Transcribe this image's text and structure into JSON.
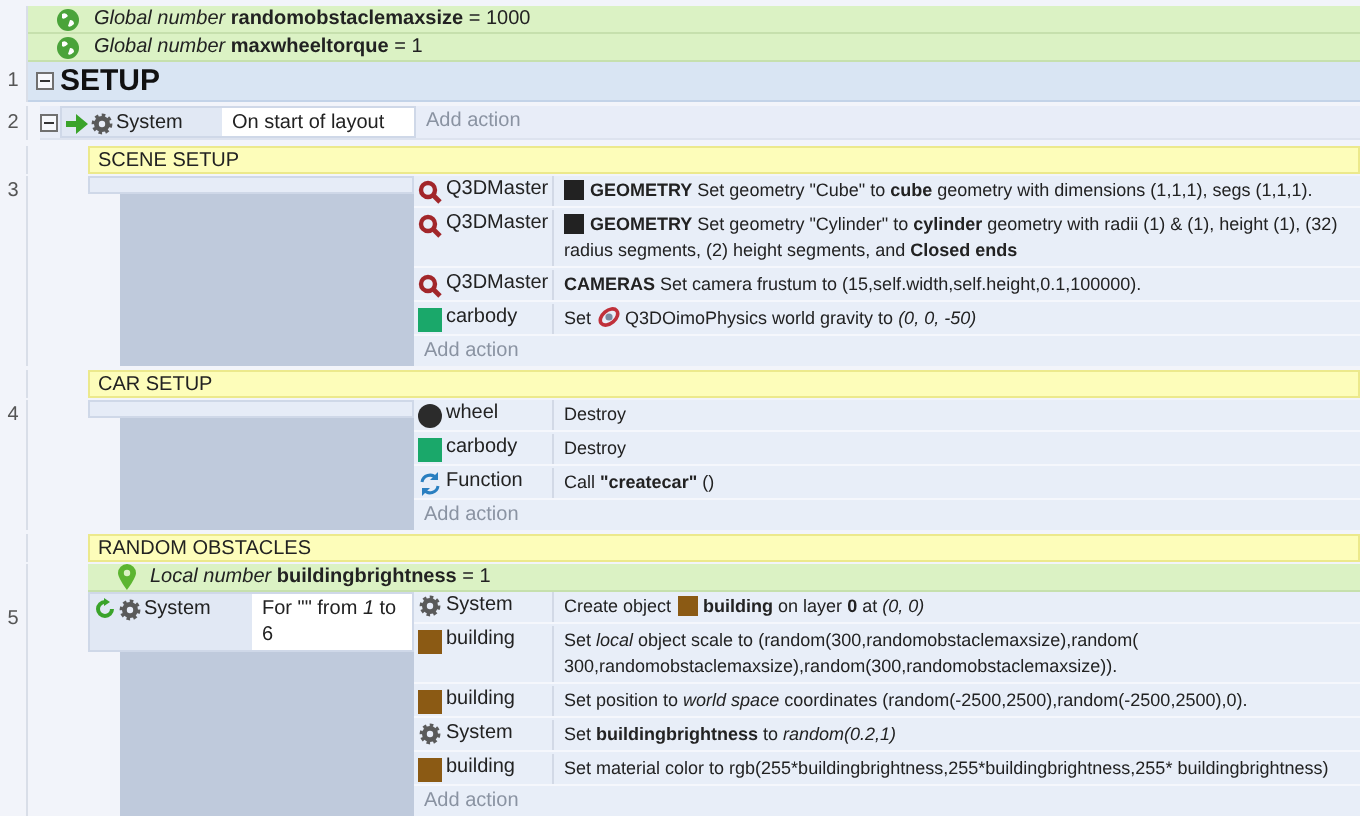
{
  "globals": [
    {
      "text": "*Global number* **randomobstaclemaxsize** = 1000"
    },
    {
      "text": "*Global number* **maxwheeltorque** = 1"
    }
  ],
  "group": {
    "number": "1",
    "title": "SETUP",
    "expanded": true,
    "event": {
      "number": "2",
      "expanded": true,
      "condition": {
        "kind": "trigger",
        "object": "System",
        "text": "On start of layout"
      },
      "add_action": "Add action",
      "subgroups": [
        {
          "title": "SCENE SETUP",
          "event": {
            "number": "3",
            "add_action": "Add action",
            "actions": [
              {
                "kind": "plugin",
                "object": "Q3DMaster",
                "segments": [
                  {
                    "kind": "swatch",
                    "color": "#222222"
                  },
                  {
                    "kind": "rich",
                    "text": "**GEOMETRY** Set geometry \"Cube\" to **cube** geometry with dimensions (1,1,1), segs (1,1,1)."
                  }
                ]
              },
              {
                "kind": "plugin",
                "object": "Q3DMaster",
                "segments": [
                  {
                    "kind": "swatch",
                    "color": "#222222"
                  },
                  {
                    "kind": "rich",
                    "text": "**GEOMETRY** Set geometry \"Cylinder\" to **cylinder** geometry with radii (1) & (1), height (1), (32) radius segments, (2) height segments, and **Closed ends**"
                  }
                ]
              },
              {
                "kind": "plugin",
                "object": "Q3DMaster",
                "segments": [
                  {
                    "kind": "rich",
                    "text": "**CAMERAS** Set camera frustum to (15,self.width,self.height,0.1,100000)."
                  }
                ]
              },
              {
                "kind": "box",
                "color": "#1aa86a",
                "object": "carbody",
                "segments": [
                  {
                    "kind": "rich",
                    "text": "Set"
                  },
                  {
                    "kind": "logo"
                  },
                  {
                    "kind": "rich",
                    "text": "Q3DOimoPhysics world gravity to *(0, 0, -50)*"
                  }
                ]
              }
            ]
          }
        },
        {
          "title": "CAR SETUP",
          "event": {
            "number": "4",
            "add_action": "Add action",
            "actions": [
              {
                "kind": "ball",
                "color": "#2b2b2b",
                "object": "wheel",
                "segments": [
                  {
                    "kind": "rich",
                    "text": "Destroy"
                  }
                ]
              },
              {
                "kind": "box",
                "color": "#1aa86a",
                "object": "carbody",
                "segments": [
                  {
                    "kind": "rich",
                    "text": "Destroy"
                  }
                ]
              },
              {
                "kind": "function",
                "object": "Function",
                "segments": [
                  {
                    "kind": "rich",
                    "text": "Call **\"createcar\"** ()"
                  }
                ]
              }
            ]
          }
        },
        {
          "title": "RANDOM OBSTACLES",
          "local": {
            "text": "*Local number* **buildingbrightness** = 1"
          },
          "event": {
            "number": "5",
            "condition": {
              "kind": "loop",
              "object": "System",
              "text": "For \"\" from *1* to 6"
            },
            "add_action": "Add action",
            "actions": [
              {
                "kind": "system",
                "object": "System",
                "segments": [
                  {
                    "kind": "rich",
                    "text": "Create object"
                  },
                  {
                    "kind": "swatch",
                    "color": "#8b5a14"
                  },
                  {
                    "kind": "rich",
                    "text": "**building** on layer **0** at *(0, 0)*"
                  }
                ]
              },
              {
                "kind": "box",
                "color": "#8b5a14",
                "object": "building",
                "segments": [
                  {
                    "kind": "rich",
                    "text": "Set *local* object scale to (random(300,randomobstaclemaxsize),random( 300,randomobstaclemaxsize),random(300,randomobstaclemaxsize))."
                  }
                ]
              },
              {
                "kind": "box",
                "color": "#8b5a14",
                "object": "building",
                "segments": [
                  {
                    "kind": "rich",
                    "text": "Set position to *world space* coordinates (random(-2500,2500),random(-2500,2500),0)."
                  }
                ]
              },
              {
                "kind": "system",
                "object": "System",
                "segments": [
                  {
                    "kind": "rich",
                    "text": "Set **buildingbrightness** to *random(0.2,1)*"
                  }
                ]
              },
              {
                "kind": "box",
                "color": "#8b5a14",
                "object": "building",
                "segments": [
                  {
                    "kind": "plain",
                    "text": "Set material color to rgb(255*buildingbrightness,255*buildingbrightness,255* buildingbrightness)"
                  }
                ]
              }
            ]
          }
        }
      ]
    }
  }
}
